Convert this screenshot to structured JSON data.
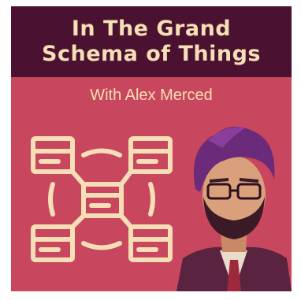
{
  "cover": {
    "title_line_1": "In The Grand",
    "title_line_2": "Schema of Things",
    "subtitle": "With Alex Merced"
  },
  "colors": {
    "background": "#c9475e",
    "title_band": "#4a1230",
    "text": "#f6dfb6"
  },
  "icons": [
    "schema-diagram-icon",
    "host-portrait-illustration"
  ]
}
